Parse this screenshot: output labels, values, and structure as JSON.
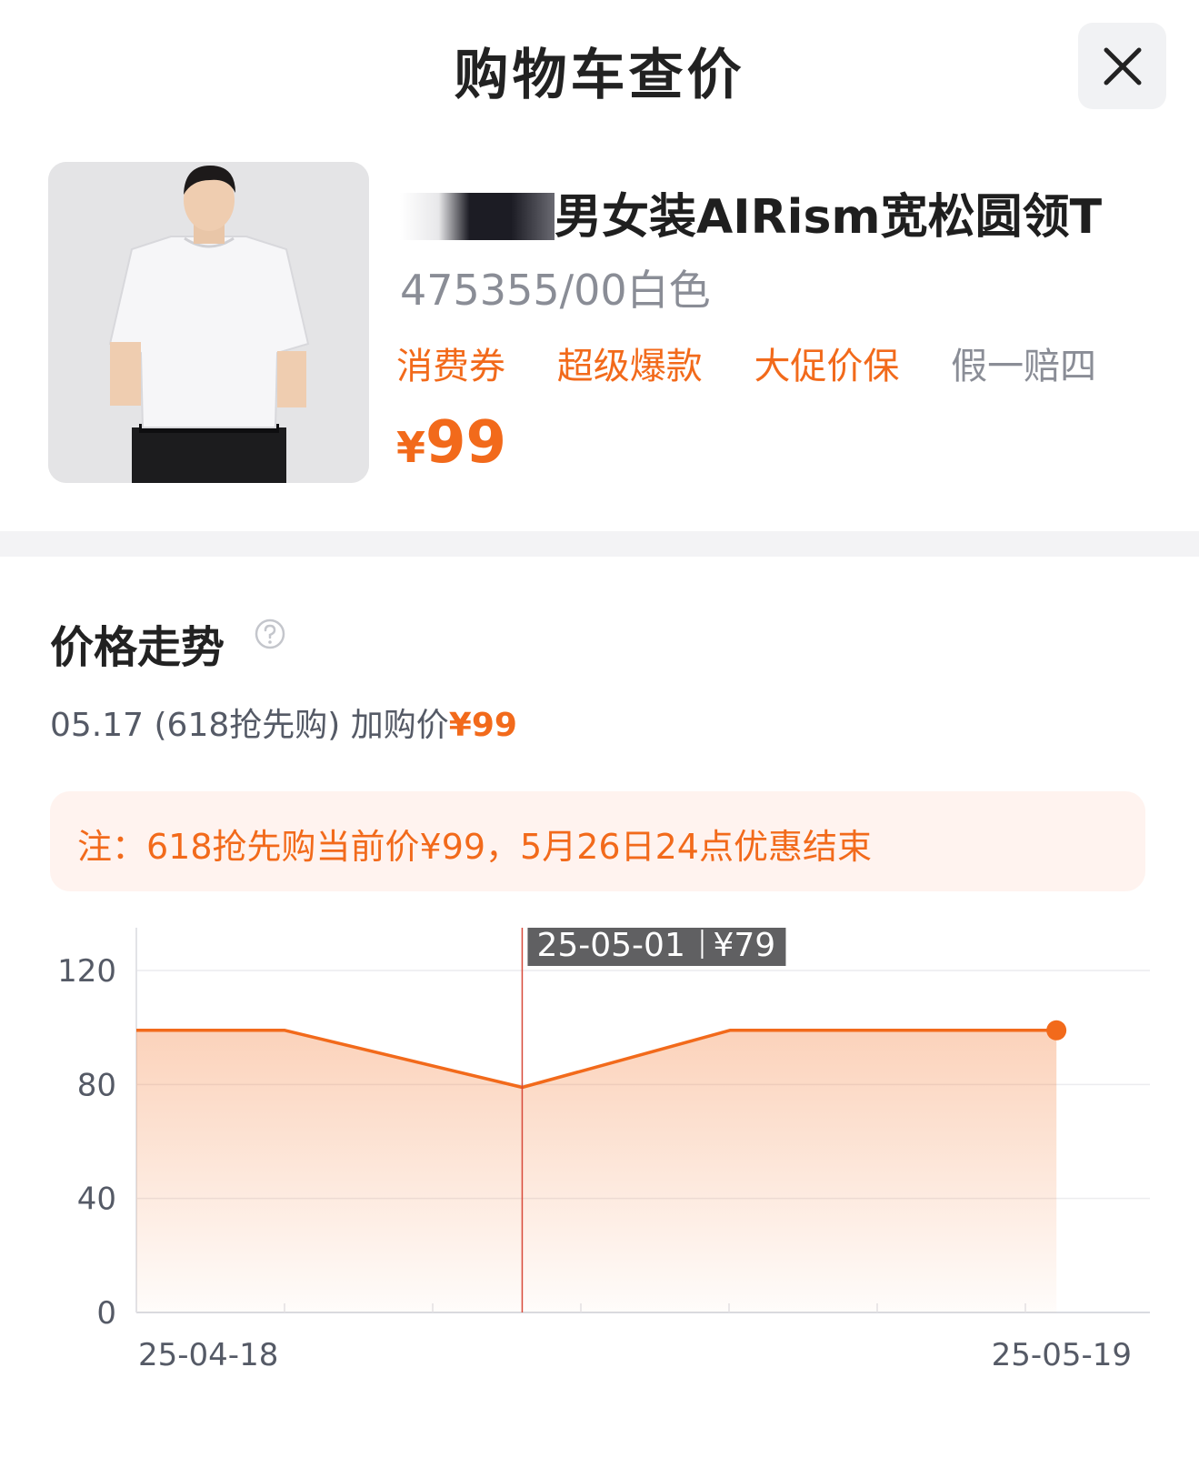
{
  "header": {
    "title": "购物车查价"
  },
  "product": {
    "title_suffix": "男女装AIRism宽松圆领T",
    "sku": "475355/00白色",
    "tags": [
      {
        "label": "消费券",
        "color": "#f26a1b"
      },
      {
        "label": "超级爆款",
        "color": "#f26a1b"
      },
      {
        "label": "大促价保",
        "color": "#f26a1b"
      },
      {
        "label": "假一赔四",
        "color": "#8a8d96"
      }
    ],
    "currency": "¥",
    "price": "99"
  },
  "trend": {
    "title": "价格走势",
    "summary_prefix": "05.17 (618抢先购) 加购价",
    "summary_price": "¥99",
    "notice": "注：618抢先购当前价¥99，5月26日24点优惠结束"
  },
  "chart_data": {
    "type": "area",
    "x": [
      "25-04-18",
      "25-04-23",
      "25-05-01",
      "25-05-08",
      "25-05-19"
    ],
    "values": [
      99,
      99,
      79,
      99,
      99
    ],
    "ylim": [
      0,
      135
    ],
    "yticks": [
      0,
      40,
      80,
      120
    ],
    "xtick_labels": [
      "25-04-18",
      "25-05-19"
    ],
    "tooltip": {
      "date": "25-05-01",
      "price": "¥79"
    },
    "color": "#f26a1b",
    "grid": true
  }
}
